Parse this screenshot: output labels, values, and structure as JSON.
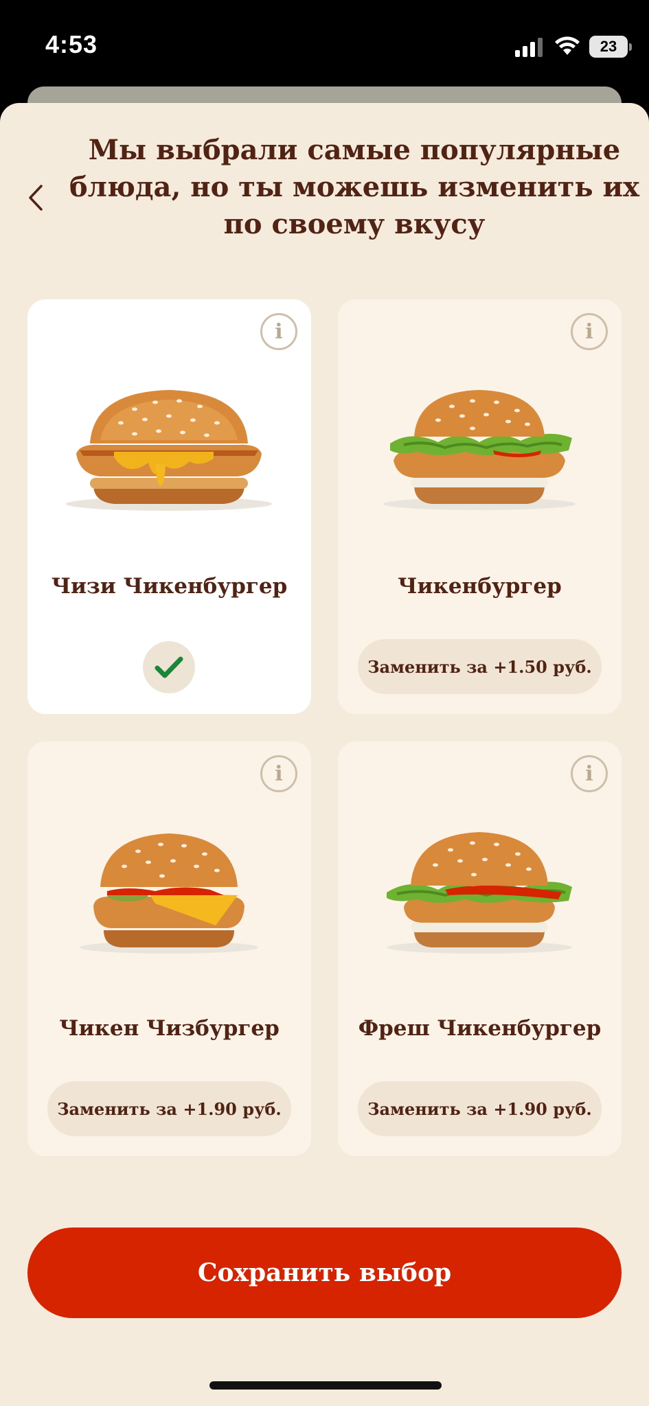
{
  "status_bar": {
    "time": "4:53",
    "battery": "23",
    "icons": [
      "signal-icon",
      "wifi-icon",
      "battery-icon"
    ]
  },
  "header": {
    "title": "Мы выбрали самые популярные блюда, но ты можешь изменить их по своему вкусу"
  },
  "cards": [
    {
      "name": "Чизи Чикенбургер",
      "selected": true,
      "action": ""
    },
    {
      "name": "Чикенбургер",
      "selected": false,
      "action": "Заменить за +1.50 руб."
    },
    {
      "name": "Чикен Чизбургер",
      "selected": false,
      "action": "Заменить за +1.90 руб."
    },
    {
      "name": "Фреш Чикенбургер",
      "selected": false,
      "action": "Заменить за +1.90 руб."
    }
  ],
  "info_label": "i",
  "footer": {
    "save_label": "Сохранить выбор"
  },
  "colors": {
    "brand_brown": "#502314",
    "brand_red": "#d62300",
    "background": "#f5ebdc",
    "card": "#fbf3e8",
    "check_green": "#198737"
  }
}
